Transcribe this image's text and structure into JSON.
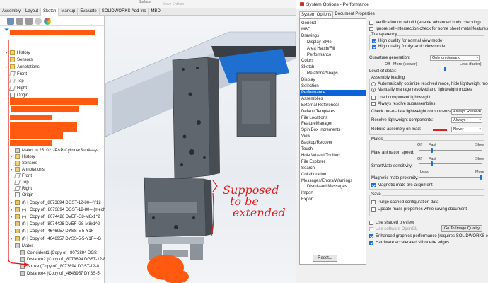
{
  "sw": {
    "top_items": [
      "Surface",
      "Move Entities"
    ],
    "tabs": [
      "Assembly",
      "Layout",
      "Sketch",
      "Markup",
      "Evaluate",
      "SOLIDWORKS Add-Ins",
      "MBD"
    ],
    "active_tab": "Sketch",
    "tree": [
      {
        "label": "History",
        "icon": "history-icon",
        "indent": 1
      },
      {
        "label": "Sensors",
        "icon": "sensor-icon",
        "indent": 1
      },
      {
        "label": "Annotations",
        "icon": "annotation-icon",
        "indent": 1
      },
      {
        "label": "Front",
        "icon": "plane-icon",
        "indent": 1
      },
      {
        "label": "Top",
        "icon": "plane-icon",
        "indent": 1
      },
      {
        "label": "Right",
        "icon": "plane-icon",
        "indent": 1
      },
      {
        "label": "Origin",
        "icon": "origin-icon",
        "indent": 1
      },
      {
        "label": "Mates in 251021-P&P-CylinderSubAssy-",
        "icon": "mate-icon",
        "indent": 2
      },
      {
        "label": "History",
        "icon": "history-icon",
        "indent": 2
      },
      {
        "label": "Sensors",
        "icon": "sensor-icon",
        "indent": 2
      },
      {
        "label": "Annotations",
        "icon": "annotation-icon",
        "indent": 2
      },
      {
        "label": "Front",
        "icon": "plane-icon",
        "indent": 2
      },
      {
        "label": "Top",
        "icon": "plane-icon",
        "indent": 2
      },
      {
        "label": "Right",
        "icon": "plane-icon",
        "indent": 2
      },
      {
        "label": "Origin",
        "icon": "origin-icon",
        "indent": 2
      },
      {
        "label": "(f) [ Copy of _8073894 DGST-12-80---Y12",
        "icon": "part-icon",
        "indent": 2
      },
      {
        "label": "(-) [ Copy of _8073894 DGST-12-80---(mech",
        "icon": "part-icon",
        "indent": 2
      },
      {
        "label": "(-) [ Copy of _8074426 DVEF-G8-M8x1^2",
        "icon": "part-icon",
        "indent": 2
      },
      {
        "label": "(f) [ Copy of _8074426 DVEF-G8-M8x1^2",
        "icon": "part-icon",
        "indent": 2
      },
      {
        "label": "(f) [ Copy of _4646957 DYSS-5-5-Y1F---",
        "icon": "part-icon",
        "indent": 2
      },
      {
        "label": "(f) [ Copy of _4646957 DYSS-5-5-Y1F---G",
        "icon": "part-icon",
        "indent": 2
      },
      {
        "label": "Mates",
        "icon": "mate-icon",
        "indent": 2
      },
      {
        "label": "Coincident1 (Copy of _8073894 DGS",
        "icon": "mate-icon",
        "indent": 3
      },
      {
        "label": "Distance2 (Copy of _8073894 DGST-12-8",
        "icon": "mate-icon",
        "indent": 3
      },
      {
        "label": "Stroke (Copy of _8073894 DGST-12-8",
        "icon": "mate-icon",
        "indent": 3
      },
      {
        "label": "Distance4 (Copy of _4646957 DYSS-5-",
        "icon": "mate-icon",
        "indent": 3
      }
    ],
    "annotation_text": [
      "Supposed",
      "to be",
      "extended"
    ]
  },
  "dialog": {
    "title": "System Options - Performance",
    "tabs": [
      "System Options",
      "Document Properties"
    ],
    "active_tab": "System Options",
    "categories": [
      {
        "label": "General",
        "indent": 0
      },
      {
        "label": "MBD",
        "indent": 0
      },
      {
        "label": "Drawings",
        "indent": 0
      },
      {
        "label": "Display Style",
        "indent": 1
      },
      {
        "label": "Area Hatch/Fill",
        "indent": 1
      },
      {
        "label": "Performance",
        "indent": 1
      },
      {
        "label": "Colors",
        "indent": 0
      },
      {
        "label": "Sketch",
        "indent": 0
      },
      {
        "label": "Relations/Snaps",
        "indent": 1
      },
      {
        "label": "Display",
        "indent": 0
      },
      {
        "label": "Selection",
        "indent": 0
      },
      {
        "label": "Performance",
        "indent": 0,
        "selected": true
      },
      {
        "label": "Assemblies",
        "indent": 0
      },
      {
        "label": "External References",
        "indent": 0
      },
      {
        "label": "Default Templates",
        "indent": 0
      },
      {
        "label": "File Locations",
        "indent": 0
      },
      {
        "label": "FeatureManager",
        "indent": 0
      },
      {
        "label": "Spin Box Increments",
        "indent": 0
      },
      {
        "label": "View",
        "indent": 0
      },
      {
        "label": "Backup/Recover",
        "indent": 0
      },
      {
        "label": "Touch",
        "indent": 0
      },
      {
        "label": "Hole Wizard/Toolbox",
        "indent": 0
      },
      {
        "label": "File Explorer",
        "indent": 0
      },
      {
        "label": "Search",
        "indent": 0
      },
      {
        "label": "Collaboration",
        "indent": 0
      },
      {
        "label": "Messages/Errors/Warnings",
        "indent": 0
      },
      {
        "label": "Dismissed Messages",
        "indent": 1
      },
      {
        "label": "Import",
        "indent": 0
      },
      {
        "label": "Export",
        "indent": 0
      }
    ],
    "reset_label": "Reset...",
    "verify_rebuild": "Verification on rebuild (enable advanced body checking)",
    "ignore_self_intersection": "Ignore self-intersection check for some sheet metal features",
    "transparency": {
      "title": "Transparency",
      "normal": "High quality for normal view mode",
      "dynamic": "High quality for dynamic view mode"
    },
    "curvature": {
      "label": "Curvature generation:",
      "value": "Only on demand"
    },
    "lod": {
      "label": "Level of detail:",
      "off": "Off",
      "more": "More (slower)",
      "less": "Less (faster)",
      "level": 0.6
    },
    "assembly_loading": {
      "title": "Assembly loading",
      "auto": "Automatically optimize resolved mode, hide lightweight mode",
      "manual": "Manually manage resolved and lightweight modes",
      "load_lightweight": "Load component lightweight",
      "resolve_sub": "Always resolve subassemblies",
      "check_label": "Check out-of-date lightweight components:",
      "check_value": "Always Resolve",
      "resolve_label": "Resolve lightweight components:",
      "resolve_value": "Always",
      "rebuild_label": "Rebuild assembly on load:",
      "rebuild_value": "Never"
    },
    "mates": {
      "title": "Mates",
      "off": "Off",
      "fast": "Fast",
      "slow": "Slow",
      "less": "Less",
      "more": "More",
      "animation_label": "Mate animation speed:",
      "animation_level": 0.2,
      "smartmate_label": "SmartMate sensitivity:",
      "smartmate_level": 0.2,
      "proximity_label": "Magnetic mate proximity:",
      "proximity_level": 1.0,
      "prealign": "Magnetic mate pre-alignment"
    },
    "save": {
      "title": "Save",
      "purge": "Purge cached configuration data",
      "update": "Update mass properties while saving document"
    },
    "shaded_preview": "Use shaded preview",
    "opengl": "Use software OpenGL",
    "image_quality_btn": "Go To Image Quality",
    "enhanced_graphics": "Enhanced graphics performance (requires SOLIDWORKS restart)",
    "hw_silhouette": "Hardware accelerated silhouette edges"
  }
}
